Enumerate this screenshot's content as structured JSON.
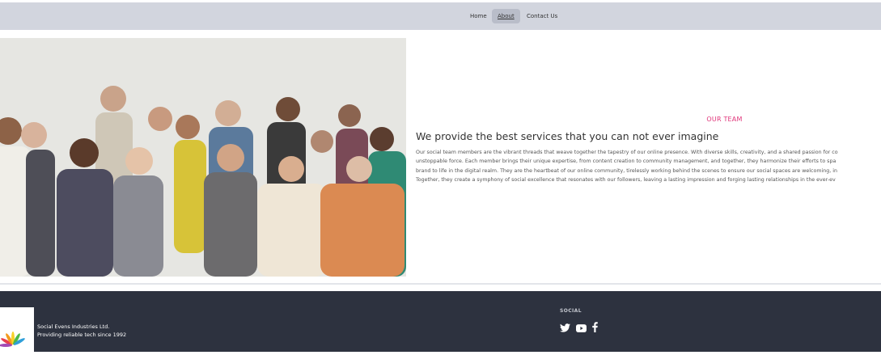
{
  "nav": {
    "items": [
      {
        "label": "Home"
      },
      {
        "label": "About"
      },
      {
        "label": "Contact Us"
      }
    ],
    "active_index": 1
  },
  "section": {
    "eyebrow": "OUR TEAM",
    "heading": "We provide the best services that you can not ever imagine",
    "paragraph_lines": [
      "Our social team members are the vibrant threads that weave together the tapestry of our online presence. With diverse skills, creativity, and a shared passion for co",
      "unstoppable force. Each member brings their unique expertise, from content creation to community management, and together, they harmonize their efforts to spa",
      "brand to life in the digital realm. They are the heartbeat of our online community, tirelessly working behind the scenes to ensure our social spaces are welcoming, in",
      "Together, they create a symphony of social excellence that resonates with our followers, leaving a lasting impression and forging lasting relationships in the ever-ev"
    ]
  },
  "footer": {
    "company_name": "Social Evens Industries Ltd.",
    "tagline": "Providing reliable tech since 1992",
    "social_title": "SOCIAL",
    "social_icons": [
      "twitter-icon",
      "youtube-icon",
      "facebook-icon"
    ]
  },
  "colors": {
    "nav_bg": "#d2d5de",
    "accent": "#e0367a",
    "footer_bg": "#2d323f"
  }
}
